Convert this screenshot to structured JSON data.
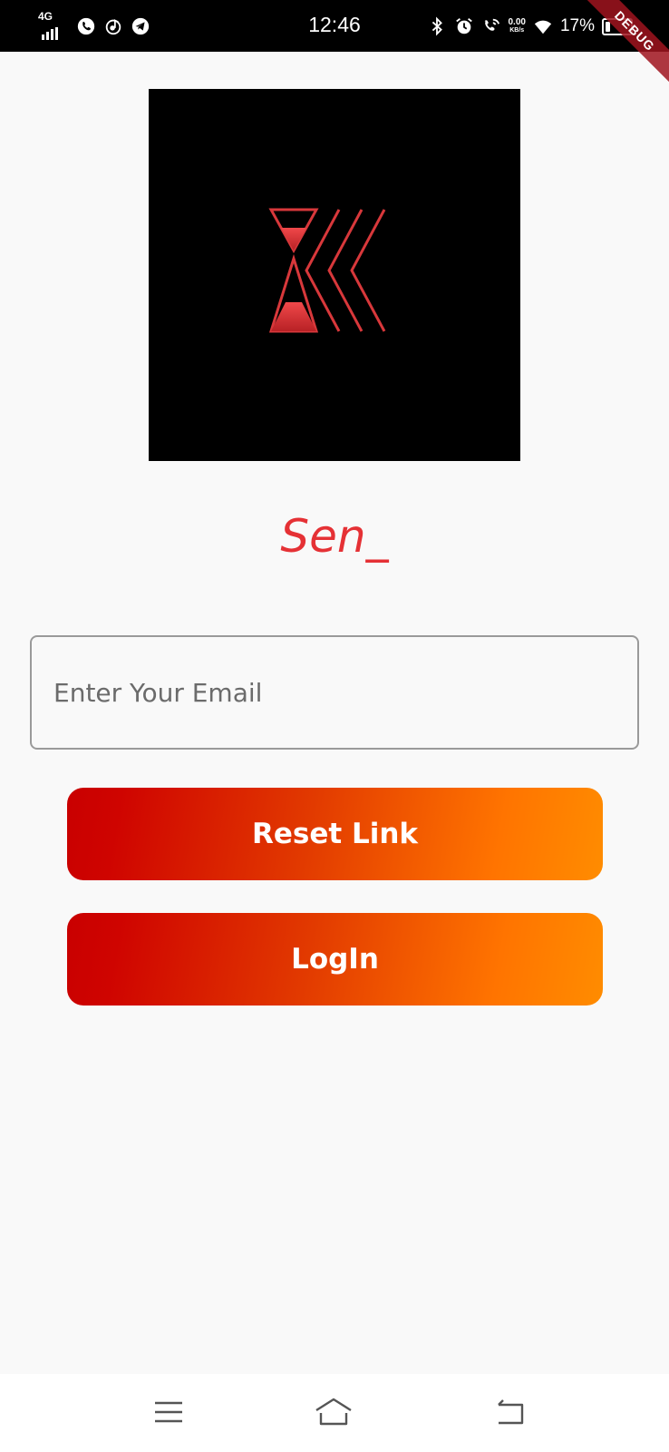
{
  "status_bar": {
    "network_type": "4G",
    "time": "12:46",
    "net_speed_value": "0.00",
    "net_speed_unit": "KB/s",
    "battery_percent": "17%"
  },
  "debug_banner": "DEBUG",
  "logo": {
    "icon": "hourglass-k-logo",
    "colors": {
      "background": "#000000",
      "accent": "#e0393c"
    }
  },
  "app_name": "Sen_",
  "email": {
    "value": "",
    "placeholder": "Enter Your Email"
  },
  "buttons": {
    "reset_label": "Reset Link",
    "login_label": "LogIn"
  },
  "navigation": {
    "items": [
      "menu-icon",
      "home-icon",
      "back-icon"
    ]
  },
  "colors": {
    "brand_red": "#e53135",
    "gradient_start": "#c90000",
    "gradient_end": "#ff8c00",
    "page_background": "#f9f9f9"
  }
}
